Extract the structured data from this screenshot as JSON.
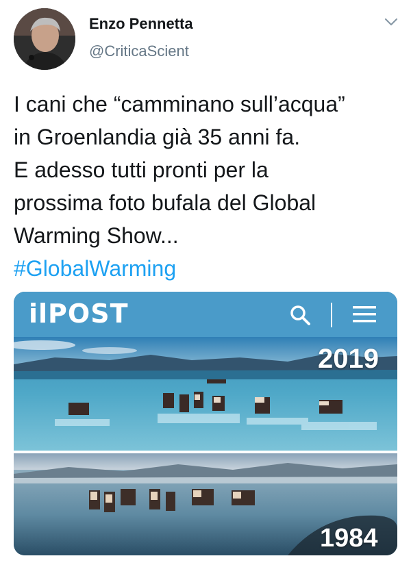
{
  "author": {
    "display_name": "Enzo Pennetta",
    "handle": "@CriticaScient"
  },
  "tweet": {
    "lines": [
      "I cani che “camminano sull’acqua”",
      "in Groenlandia già 35 anni fa.",
      "E adesso tutti pronti per la",
      "prossima foto bufala del Global",
      "Warming Show..."
    ],
    "hashtag": "#GlobalWarming"
  },
  "media": {
    "site_logo": "ilPOST",
    "year_top": "2019",
    "year_bottom": "1984",
    "icons": [
      "search-icon",
      "menu-icon",
      "chevron-down-icon"
    ]
  },
  "colors": {
    "link": "#1da1f2",
    "handle": "#657786",
    "post_bar": "#4a9bc9"
  }
}
